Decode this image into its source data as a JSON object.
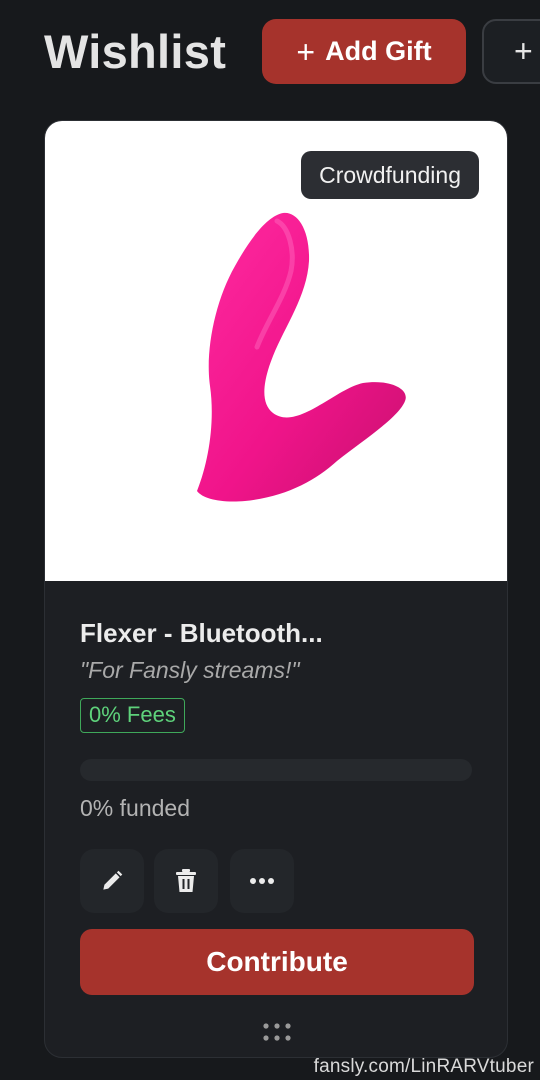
{
  "header": {
    "title": "Wishlist",
    "add_gift_label": "Add Gift",
    "add_gift_icon": "plus-icon",
    "extra_button_icon": "plus-icon"
  },
  "card": {
    "badge": "Crowdfunding",
    "product_name": "Flexer - Bluetooth...",
    "note": "\"For Fansly streams!\"",
    "fees_label": "0% Fees",
    "funded_fraction": 0,
    "funded_text": "0% funded",
    "actions": [
      {
        "name": "edit-button",
        "icon": "pencil-icon"
      },
      {
        "name": "delete-button",
        "icon": "trash-icon"
      },
      {
        "name": "more-button",
        "icon": "more-horizontal-icon"
      }
    ],
    "contribute_label": "Contribute",
    "drag_icon": "drag-handle-icon"
  },
  "watermark": "fansly.com/LinRARVtuber",
  "colors": {
    "background": "#17191c",
    "card": "#1d1f23",
    "accent": "#a6332c",
    "fees_green": "#5ed27b",
    "product_pink": "#ff1493"
  }
}
